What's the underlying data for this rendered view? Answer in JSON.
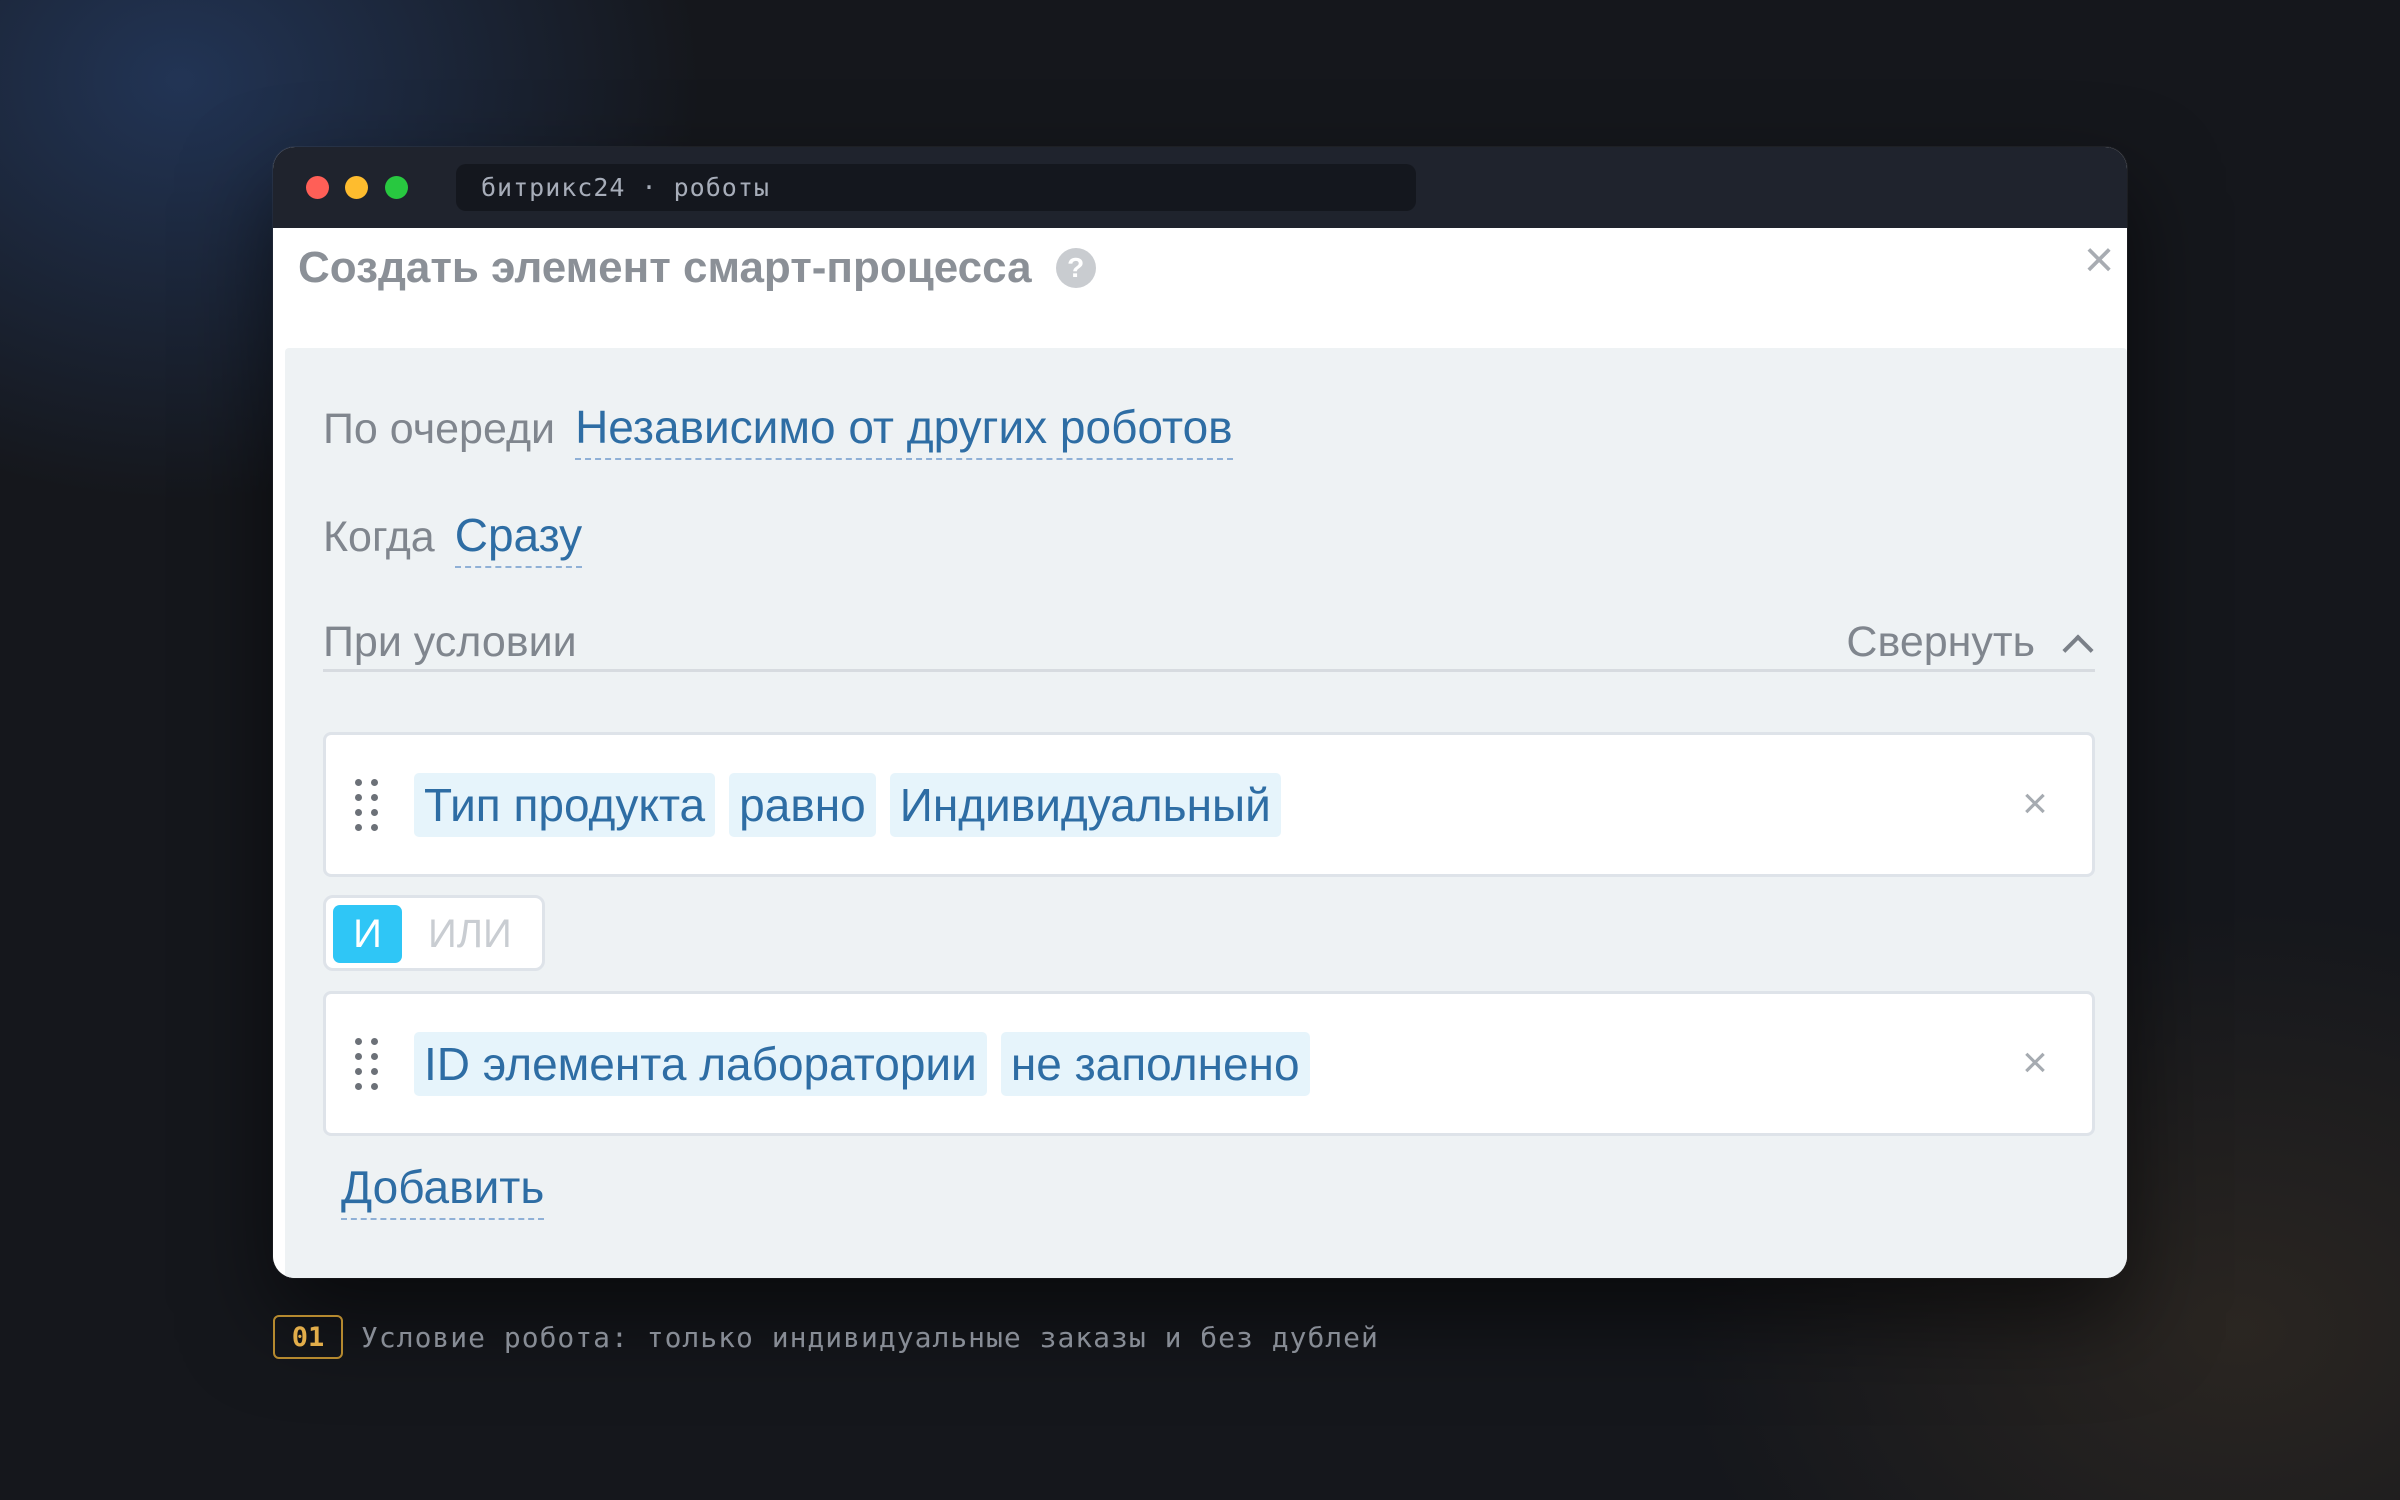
{
  "window": {
    "address": "битрикс24 · роботы"
  },
  "dialog": {
    "title": "Создать элемент смарт-процесса",
    "help_icon": "?",
    "close_icon": "×"
  },
  "settings": {
    "queue_label": "По очереди",
    "queue_value": "Независимо от других роботов",
    "when_label": "Когда",
    "when_value": "Сразу"
  },
  "conditions": {
    "title": "При условии",
    "collapse_label": "Свернуть",
    "items": [
      {
        "field": "Тип продукта",
        "operator": "равно",
        "value": "Индивидуальный",
        "remove": "×"
      },
      {
        "field": "ID элемента лаборатории",
        "operator": "не заполнено",
        "remove": "×"
      }
    ],
    "logic": {
      "and_label": "И",
      "or_label": "ИЛИ",
      "selected": "И"
    },
    "add_label": "Добавить"
  },
  "caption": {
    "number": "01",
    "text": "Условие робота: только индивидуальные заказы и без дублей"
  },
  "colors": {
    "accent": "#2fc6f6",
    "link": "#2e6da4",
    "chip_bg": "#e6f4fb",
    "panel_bg": "#eef2f4",
    "caption_badge": "#e2ad4a"
  },
  "icons": {
    "help": "help-icon",
    "close": "close-icon",
    "collapse": "chevron-up-icon",
    "drag": "drag-handle-icon",
    "remove": "remove-icon"
  }
}
